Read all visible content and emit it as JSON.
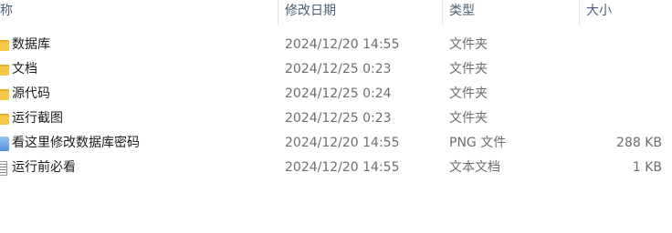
{
  "header": {
    "name_label": "称",
    "date_label": "修改日期",
    "type_label": "类型",
    "size_label": "大小",
    "sort_indicator": "^"
  },
  "files": [
    {
      "name": "数据库",
      "date": "2024/12/20 14:55",
      "type": "文件夹",
      "size": "",
      "icon": "folder-icon"
    },
    {
      "name": "文档",
      "date": "2024/12/25 0:23",
      "type": "文件夹",
      "size": "",
      "icon": "folder-icon"
    },
    {
      "name": "源代码",
      "date": "2024/12/25 0:24",
      "type": "文件夹",
      "size": "",
      "icon": "folder-icon"
    },
    {
      "name": "运行截图",
      "date": "2024/12/25 0:23",
      "type": "文件夹",
      "size": "",
      "icon": "folder-icon"
    },
    {
      "name": "看这里修改数据库密码",
      "date": "2024/12/20 14:55",
      "type": "PNG 文件",
      "size": "288 KB",
      "icon": "png-file-icon"
    },
    {
      "name": "运行前必看",
      "date": "2024/12/20 14:55",
      "type": "文本文档",
      "size": "1 KB",
      "icon": "text-file-icon"
    }
  ]
}
